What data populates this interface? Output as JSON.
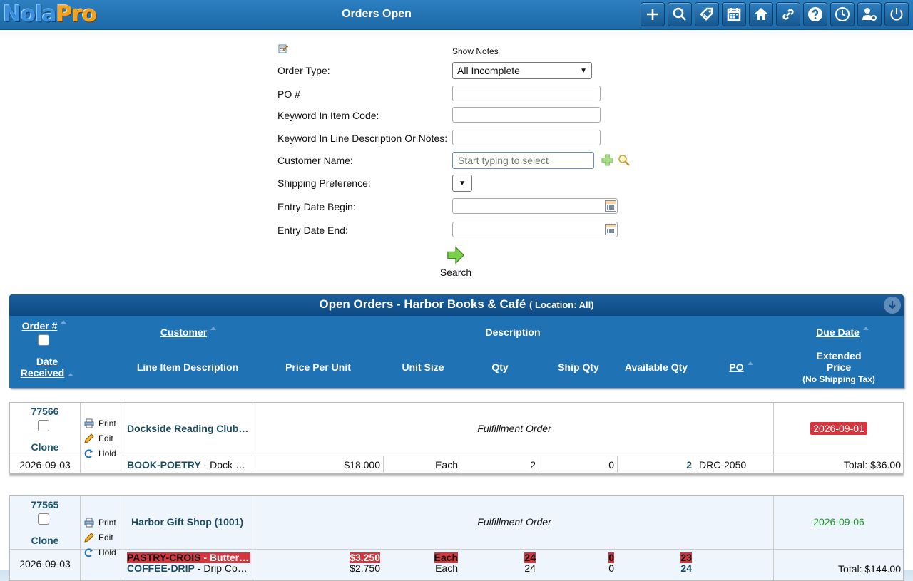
{
  "app": {
    "logo_a": "Nola",
    "logo_b": "Pro",
    "title": "Orders Open"
  },
  "toolbar": {
    "icons": [
      "add-icon",
      "search-icon",
      "tag-icon",
      "calendar-icon",
      "home-icon",
      "link-icon",
      "help-icon",
      "clock-icon",
      "user-settings-icon",
      "power-icon"
    ]
  },
  "form": {
    "show_notes": "Show Notes",
    "order_type_label": "Order Type:",
    "order_type_value": "All Incomplete",
    "po_label": "PO #",
    "item_code_label": "Keyword In Item Code:",
    "line_desc_label": "Keyword In Line Description Or Notes:",
    "customer_label": "Customer Name:",
    "customer_placeholder": "Start typing to select",
    "shipping_label": "Shipping Preference:",
    "entry_begin_label": "Entry Date Begin:",
    "entry_end_label": "Entry Date End:",
    "search_label": "Search"
  },
  "panel": {
    "title": "Open Orders - Harbor Books & Café",
    "location": "( Location: All)",
    "headers": {
      "order_no": "Order #",
      "customer": "Customer",
      "description": "Description",
      "due_date": "Due Date",
      "date_received": "Date Received",
      "line_item": "Line Item Description",
      "price_per_unit": "Price Per Unit",
      "unit_size": "Unit Size",
      "qty": "Qty",
      "ship_qty": "Ship Qty",
      "available_qty": "Available Qty",
      "po": "PO",
      "extended_price": "Extended Price",
      "no_shipping_tax": "(No Shipping Tax)"
    }
  },
  "actions": {
    "clone": "Clone",
    "print": "Print",
    "edit": "Edit",
    "hold": "Hold"
  },
  "orders": [
    {
      "number": "77566",
      "customer": "Dockside Reading Club…",
      "type": "Fulfillment Order",
      "due": "2026-09-01",
      "date": "2026-09-03",
      "lines": [
        {
          "code": "BOOK-POETRY",
          "desc": " - Dock …",
          "price": "$18.000",
          "unit": "Each",
          "qty": "2",
          "ship": "0",
          "avail": "2",
          "po": "DRC-2050"
        }
      ],
      "total": "Total: $36.00"
    },
    {
      "number": "77565",
      "customer": "Harbor Gift Shop (1001)",
      "type": "Fulfillment Order",
      "due": "2026-09-06",
      "date": "2026-09-03",
      "lines": [
        {
          "code": "PASTRY-CROIS",
          "desc": " - Butter…",
          "price": "$3.250",
          "unit": "Each",
          "qty": "24",
          "ship": "0",
          "avail": "23"
        },
        {
          "code": "COFFEE-DRIP",
          "desc": " - Drip Co…",
          "price": "$2.750",
          "unit": "Each",
          "qty": "24",
          "ship": "0",
          "avail": "24"
        }
      ],
      "total": "Total: $144.00"
    }
  ]
}
